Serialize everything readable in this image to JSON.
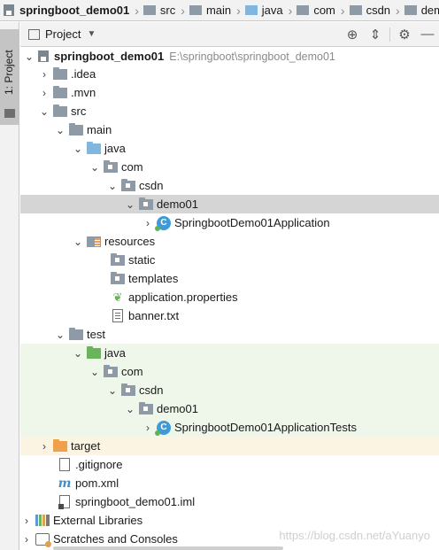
{
  "breadcrumbs": [
    {
      "label": "springboot_demo01",
      "icon": "project-icon"
    },
    {
      "label": "src",
      "icon": "folder-icon"
    },
    {
      "label": "main",
      "icon": "folder-icon"
    },
    {
      "label": "java",
      "icon": "source-folder-icon"
    },
    {
      "label": "com",
      "icon": "folder-icon"
    },
    {
      "label": "csdn",
      "icon": "folder-icon"
    },
    {
      "label": "demo",
      "icon": "folder-icon"
    }
  ],
  "side_stripe": {
    "tab_label": "1: Project"
  },
  "panel": {
    "title": "Project",
    "tools": {
      "locate": "⊕",
      "collapse": "⇕",
      "settings": "⚙",
      "hide": "—"
    }
  },
  "tree": [
    {
      "label": "springboot_demo01",
      "path": "E:\\springboot\\springboot_demo01",
      "arrow": "⌄"
    },
    {
      "label": ".idea",
      "arrow": "›"
    },
    {
      "label": ".mvn",
      "arrow": "›"
    },
    {
      "label": "src",
      "arrow": "⌄"
    },
    {
      "label": "main",
      "arrow": "⌄"
    },
    {
      "label": "java",
      "arrow": "⌄"
    },
    {
      "label": "com",
      "arrow": "⌄"
    },
    {
      "label": "csdn",
      "arrow": "⌄"
    },
    {
      "label": "demo01",
      "arrow": "⌄"
    },
    {
      "label": "SpringbootDemo01Application",
      "arrow": "›",
      "badge": "C"
    },
    {
      "label": "resources",
      "arrow": "⌄"
    },
    {
      "label": "static",
      "arrow": ""
    },
    {
      "label": "templates",
      "arrow": ""
    },
    {
      "label": "application.properties",
      "arrow": ""
    },
    {
      "label": "banner.txt",
      "arrow": ""
    },
    {
      "label": "test",
      "arrow": "⌄"
    },
    {
      "label": "java",
      "arrow": "⌄"
    },
    {
      "label": "com",
      "arrow": "⌄"
    },
    {
      "label": "csdn",
      "arrow": "⌄"
    },
    {
      "label": "demo01",
      "arrow": "⌄"
    },
    {
      "label": "SpringbootDemo01ApplicationTests",
      "arrow": "›",
      "badge": "C"
    },
    {
      "label": "target",
      "arrow": "›"
    },
    {
      "label": ".gitignore",
      "arrow": ""
    },
    {
      "label": "pom.xml",
      "arrow": "",
      "badge": "m"
    },
    {
      "label": "springboot_demo01.iml",
      "arrow": ""
    },
    {
      "label": "External Libraries",
      "arrow": "›"
    },
    {
      "label": "Scratches and Consoles",
      "arrow": "›"
    }
  ],
  "watermark": "https://blog.csdn.net/aYuanyo",
  "colors": {
    "selection": "#d5d5d5",
    "test_highlight": "#eff7ea",
    "source_folder": "#7fb7e0",
    "test_folder": "#6ab55b",
    "excluded_folder": "#f0a04a"
  }
}
